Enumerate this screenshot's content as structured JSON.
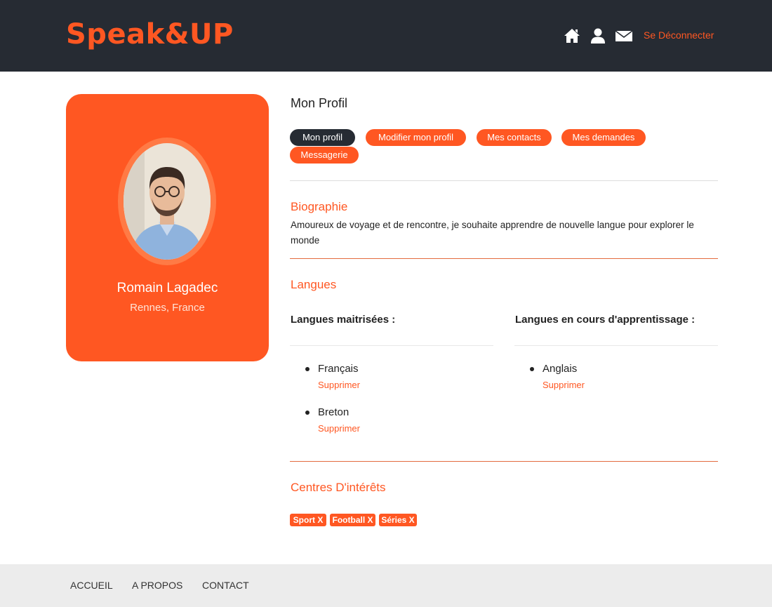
{
  "header": {
    "logo": "Speak&UP",
    "logout_label": "Se Déconnecter",
    "icons": [
      "home-icon",
      "user-icon",
      "mail-icon"
    ]
  },
  "profile": {
    "name": "Romain Lagadec",
    "location": "Rennes, France"
  },
  "main": {
    "title": "Mon Profil",
    "tabs": [
      {
        "label": "Mon profil",
        "active": true
      },
      {
        "label": "Modifier mon profil",
        "active": false
      },
      {
        "label": "Mes contacts",
        "active": false
      },
      {
        "label": "Mes demandes",
        "active": false
      },
      {
        "label": "Messagerie",
        "active": false
      }
    ],
    "biography": {
      "title": "Biographie",
      "text": "Amoureux de voyage et de rencontre, je souhaite apprendre de nouvelle langue pour explorer le monde"
    },
    "languages": {
      "title": "Langues",
      "mastered_title": "Langues maitrisées :",
      "learning_title": "Langues en cours d'apprentissage :",
      "mastered": [
        {
          "name": "Français",
          "action": "Supprimer"
        },
        {
          "name": "Breton",
          "action": "Supprimer"
        }
      ],
      "learning": [
        {
          "name": "Anglais",
          "action": "Supprimer"
        }
      ]
    },
    "interests": {
      "title": "Centres D'intérêts",
      "tags": [
        "Sport X",
        "Football X",
        "Séries X"
      ]
    }
  },
  "footer": {
    "links": [
      "ACCUEIL",
      "A PROPOS",
      "CONTACT"
    ]
  },
  "colors": {
    "accent": "#ff5722",
    "header_bg": "#262b33",
    "footer_bg": "#ececec"
  }
}
